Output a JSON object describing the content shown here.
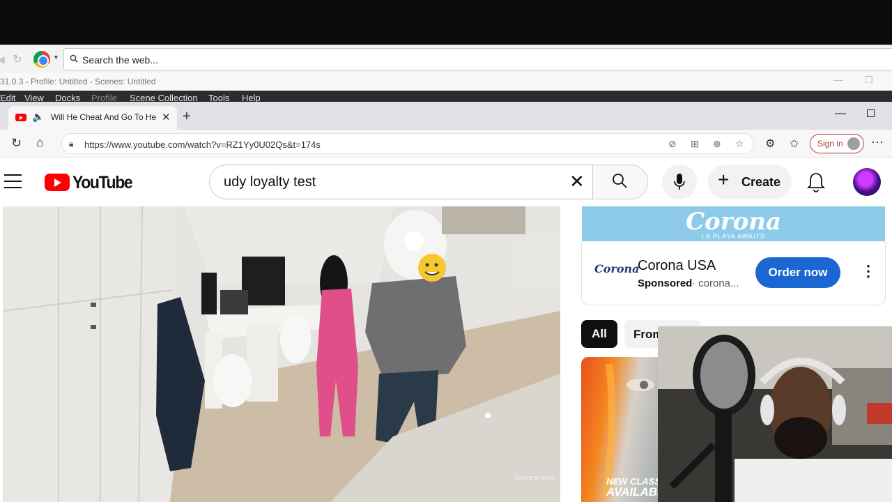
{
  "outer_browser": {
    "search_placeholder": "Search the web..."
  },
  "obs": {
    "title": "31.0.3 - Profile: Untitled - Scenes: Untitled",
    "menu": [
      "Edit",
      "View",
      "Docks",
      "Profile",
      "Scene Collection",
      "Tools",
      "Help"
    ]
  },
  "browser": {
    "tab_title": "Will He Cheat And Go To Her",
    "url": "https://www.youtube.com/watch?v=RZ1Yy0U02Qs&t=174s",
    "signin_label": "Sign in"
  },
  "youtube": {
    "logo_text": "YouTube",
    "search_query": "udy loyalty test",
    "create_label": "Create",
    "ad": {
      "banner_title": "Corona",
      "banner_subtitle": "LA PLAYA AWAITS",
      "logo_text": "Corona",
      "advertiser": "Corona USA",
      "sponsored": "Sponsored",
      "domain": "· corona...",
      "cta": "Order now"
    },
    "chips": [
      "All",
      "From"
    ],
    "thumbnail_text": [
      "NEW CLASS",
      "AVAILABL"
    ],
    "video_watermark": "lovenest lewis"
  },
  "colors": {
    "youtube_red": "#ff0000",
    "cta_blue": "#1a66d2",
    "obs_menu_bg": "#2b2b30"
  }
}
